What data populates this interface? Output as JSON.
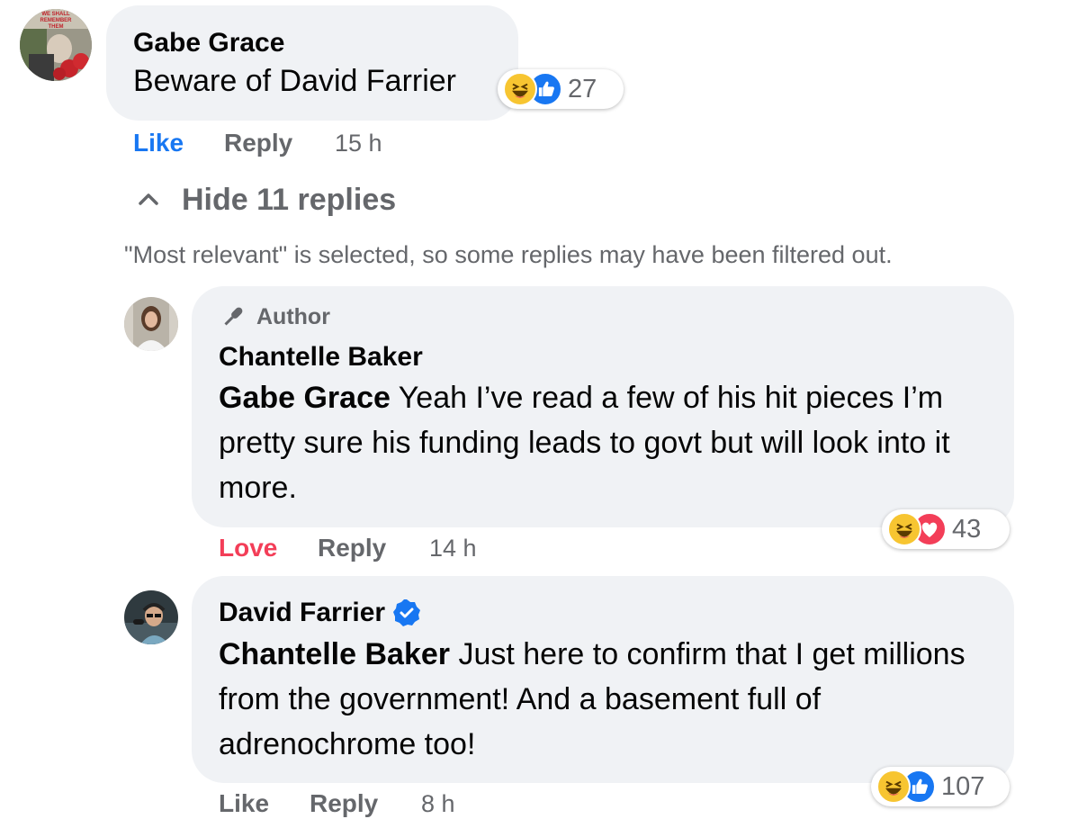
{
  "comments": [
    {
      "author": "Gabe Grace",
      "text": "Beware of David Farrier",
      "reaction_count": "27",
      "reactions": [
        "haha-icon",
        "like-icon"
      ],
      "actions": {
        "like": "Like",
        "reply": "Reply",
        "time": "15 h"
      },
      "avatar_text": "WE SHALL REMEMBER THEM"
    }
  ],
  "replies_toggle": {
    "label": "Hide 11 replies"
  },
  "filter_notice": "\"Most relevant\" is selected, so some replies may have been filtered out.",
  "replies": [
    {
      "badge": "Author",
      "author": "Chantelle Baker",
      "mention": "Gabe Grace",
      "text": " Yeah I’ve read a few of his hit pieces I’m pretty sure his funding leads to govt but will look into it more.",
      "reaction_count": "43",
      "reactions": [
        "haha-icon",
        "love-icon"
      ],
      "actions": {
        "like": "Love",
        "reply": "Reply",
        "time": "14 h"
      }
    },
    {
      "author": "David Farrier",
      "verified": true,
      "mention": "Chantelle Baker",
      "text": " Just here to confirm that I get millions from the government! And a basement full of adrenochrome too!",
      "reaction_count": "107",
      "reactions": [
        "haha-icon",
        "like-icon"
      ],
      "actions": {
        "like": "Like",
        "reply": "Reply",
        "time": "8 h"
      }
    }
  ],
  "colors": {
    "bubble": "#f0f2f5",
    "like_active": "#1877f2",
    "love_active": "#f33e58",
    "meta": "#65676b",
    "haha": "#f7c531"
  }
}
